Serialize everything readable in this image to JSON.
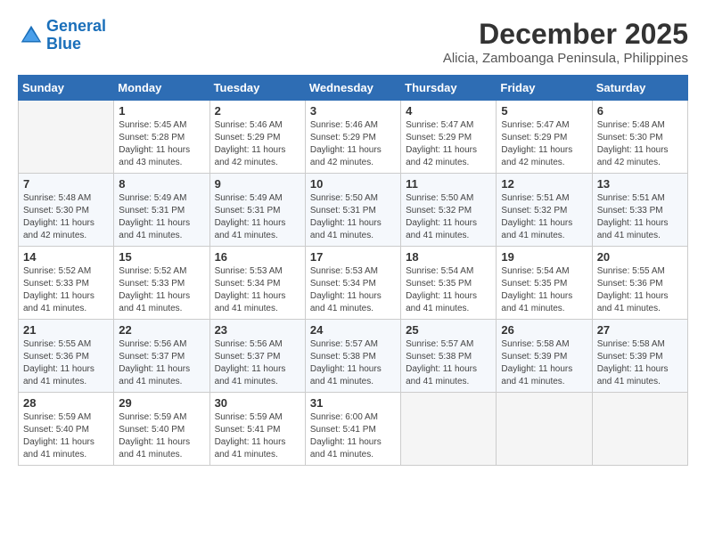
{
  "header": {
    "logo_line1": "General",
    "logo_line2": "Blue",
    "month_title": "December 2025",
    "location": "Alicia, Zamboanga Peninsula, Philippines"
  },
  "days_of_week": [
    "Sunday",
    "Monday",
    "Tuesday",
    "Wednesday",
    "Thursday",
    "Friday",
    "Saturday"
  ],
  "weeks": [
    [
      {
        "day": "",
        "sunrise": "",
        "sunset": "",
        "daylight": ""
      },
      {
        "day": "1",
        "sunrise": "Sunrise: 5:45 AM",
        "sunset": "Sunset: 5:28 PM",
        "daylight": "Daylight: 11 hours and 43 minutes."
      },
      {
        "day": "2",
        "sunrise": "Sunrise: 5:46 AM",
        "sunset": "Sunset: 5:29 PM",
        "daylight": "Daylight: 11 hours and 42 minutes."
      },
      {
        "day": "3",
        "sunrise": "Sunrise: 5:46 AM",
        "sunset": "Sunset: 5:29 PM",
        "daylight": "Daylight: 11 hours and 42 minutes."
      },
      {
        "day": "4",
        "sunrise": "Sunrise: 5:47 AM",
        "sunset": "Sunset: 5:29 PM",
        "daylight": "Daylight: 11 hours and 42 minutes."
      },
      {
        "day": "5",
        "sunrise": "Sunrise: 5:47 AM",
        "sunset": "Sunset: 5:29 PM",
        "daylight": "Daylight: 11 hours and 42 minutes."
      },
      {
        "day": "6",
        "sunrise": "Sunrise: 5:48 AM",
        "sunset": "Sunset: 5:30 PM",
        "daylight": "Daylight: 11 hours and 42 minutes."
      }
    ],
    [
      {
        "day": "7",
        "sunrise": "Sunrise: 5:48 AM",
        "sunset": "Sunset: 5:30 PM",
        "daylight": "Daylight: 11 hours and 42 minutes."
      },
      {
        "day": "8",
        "sunrise": "Sunrise: 5:49 AM",
        "sunset": "Sunset: 5:31 PM",
        "daylight": "Daylight: 11 hours and 41 minutes."
      },
      {
        "day": "9",
        "sunrise": "Sunrise: 5:49 AM",
        "sunset": "Sunset: 5:31 PM",
        "daylight": "Daylight: 11 hours and 41 minutes."
      },
      {
        "day": "10",
        "sunrise": "Sunrise: 5:50 AM",
        "sunset": "Sunset: 5:31 PM",
        "daylight": "Daylight: 11 hours and 41 minutes."
      },
      {
        "day": "11",
        "sunrise": "Sunrise: 5:50 AM",
        "sunset": "Sunset: 5:32 PM",
        "daylight": "Daylight: 11 hours and 41 minutes."
      },
      {
        "day": "12",
        "sunrise": "Sunrise: 5:51 AM",
        "sunset": "Sunset: 5:32 PM",
        "daylight": "Daylight: 11 hours and 41 minutes."
      },
      {
        "day": "13",
        "sunrise": "Sunrise: 5:51 AM",
        "sunset": "Sunset: 5:33 PM",
        "daylight": "Daylight: 11 hours and 41 minutes."
      }
    ],
    [
      {
        "day": "14",
        "sunrise": "Sunrise: 5:52 AM",
        "sunset": "Sunset: 5:33 PM",
        "daylight": "Daylight: 11 hours and 41 minutes."
      },
      {
        "day": "15",
        "sunrise": "Sunrise: 5:52 AM",
        "sunset": "Sunset: 5:33 PM",
        "daylight": "Daylight: 11 hours and 41 minutes."
      },
      {
        "day": "16",
        "sunrise": "Sunrise: 5:53 AM",
        "sunset": "Sunset: 5:34 PM",
        "daylight": "Daylight: 11 hours and 41 minutes."
      },
      {
        "day": "17",
        "sunrise": "Sunrise: 5:53 AM",
        "sunset": "Sunset: 5:34 PM",
        "daylight": "Daylight: 11 hours and 41 minutes."
      },
      {
        "day": "18",
        "sunrise": "Sunrise: 5:54 AM",
        "sunset": "Sunset: 5:35 PM",
        "daylight": "Daylight: 11 hours and 41 minutes."
      },
      {
        "day": "19",
        "sunrise": "Sunrise: 5:54 AM",
        "sunset": "Sunset: 5:35 PM",
        "daylight": "Daylight: 11 hours and 41 minutes."
      },
      {
        "day": "20",
        "sunrise": "Sunrise: 5:55 AM",
        "sunset": "Sunset: 5:36 PM",
        "daylight": "Daylight: 11 hours and 41 minutes."
      }
    ],
    [
      {
        "day": "21",
        "sunrise": "Sunrise: 5:55 AM",
        "sunset": "Sunset: 5:36 PM",
        "daylight": "Daylight: 11 hours and 41 minutes."
      },
      {
        "day": "22",
        "sunrise": "Sunrise: 5:56 AM",
        "sunset": "Sunset: 5:37 PM",
        "daylight": "Daylight: 11 hours and 41 minutes."
      },
      {
        "day": "23",
        "sunrise": "Sunrise: 5:56 AM",
        "sunset": "Sunset: 5:37 PM",
        "daylight": "Daylight: 11 hours and 41 minutes."
      },
      {
        "day": "24",
        "sunrise": "Sunrise: 5:57 AM",
        "sunset": "Sunset: 5:38 PM",
        "daylight": "Daylight: 11 hours and 41 minutes."
      },
      {
        "day": "25",
        "sunrise": "Sunrise: 5:57 AM",
        "sunset": "Sunset: 5:38 PM",
        "daylight": "Daylight: 11 hours and 41 minutes."
      },
      {
        "day": "26",
        "sunrise": "Sunrise: 5:58 AM",
        "sunset": "Sunset: 5:39 PM",
        "daylight": "Daylight: 11 hours and 41 minutes."
      },
      {
        "day": "27",
        "sunrise": "Sunrise: 5:58 AM",
        "sunset": "Sunset: 5:39 PM",
        "daylight": "Daylight: 11 hours and 41 minutes."
      }
    ],
    [
      {
        "day": "28",
        "sunrise": "Sunrise: 5:59 AM",
        "sunset": "Sunset: 5:40 PM",
        "daylight": "Daylight: 11 hours and 41 minutes."
      },
      {
        "day": "29",
        "sunrise": "Sunrise: 5:59 AM",
        "sunset": "Sunset: 5:40 PM",
        "daylight": "Daylight: 11 hours and 41 minutes."
      },
      {
        "day": "30",
        "sunrise": "Sunrise: 5:59 AM",
        "sunset": "Sunset: 5:41 PM",
        "daylight": "Daylight: 11 hours and 41 minutes."
      },
      {
        "day": "31",
        "sunrise": "Sunrise: 6:00 AM",
        "sunset": "Sunset: 5:41 PM",
        "daylight": "Daylight: 11 hours and 41 minutes."
      },
      {
        "day": "",
        "sunrise": "",
        "sunset": "",
        "daylight": ""
      },
      {
        "day": "",
        "sunrise": "",
        "sunset": "",
        "daylight": ""
      },
      {
        "day": "",
        "sunrise": "",
        "sunset": "",
        "daylight": ""
      }
    ]
  ]
}
